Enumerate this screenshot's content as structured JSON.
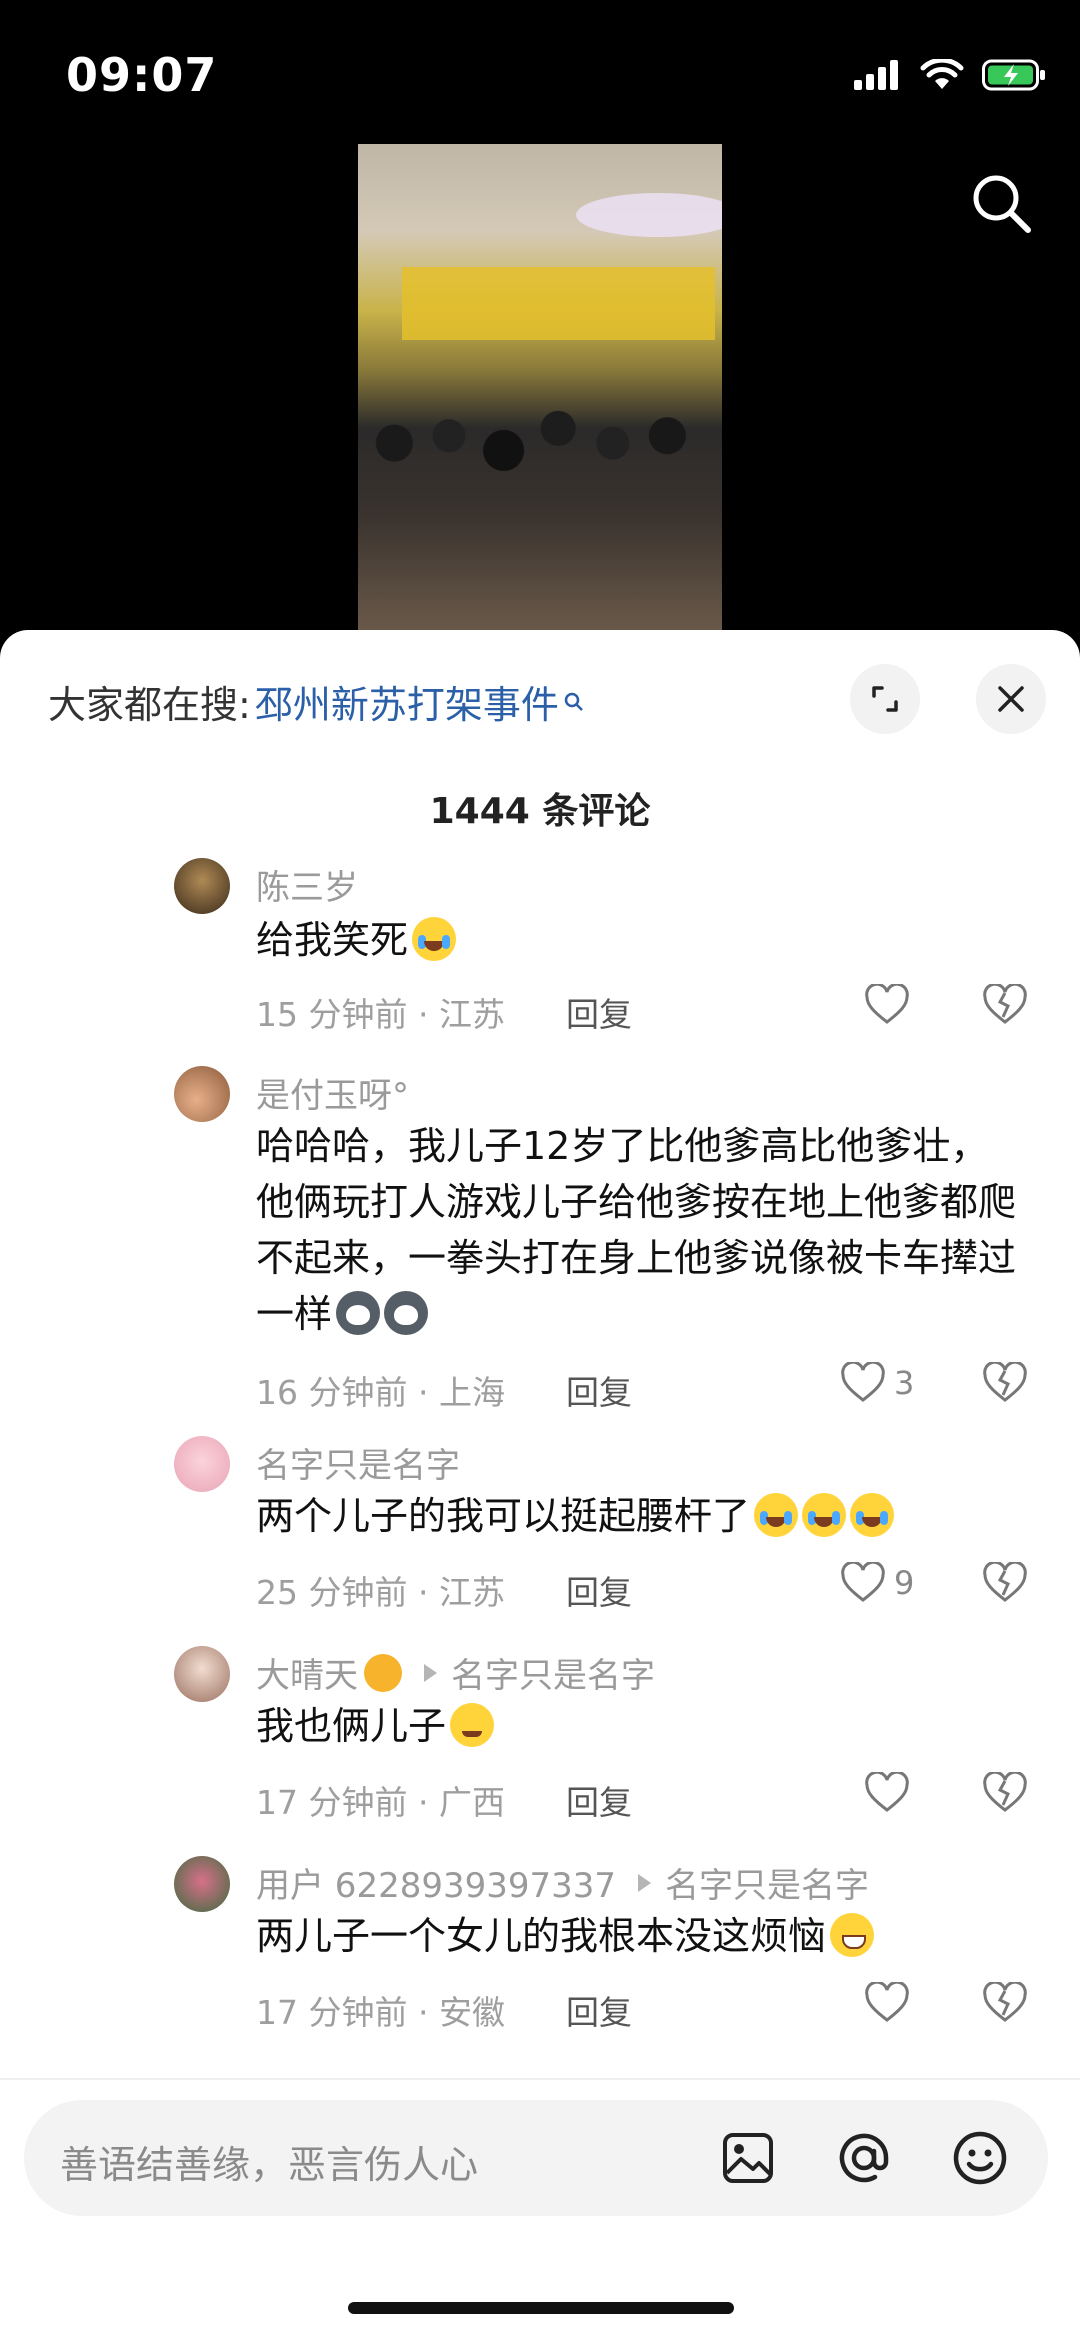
{
  "status": {
    "time": "09:07"
  },
  "search": {
    "prefix": "大家都在搜:",
    "term": "邳州新苏打架事件"
  },
  "comments_header": {
    "count_label": "1444 条评论"
  },
  "reply_label": "回复",
  "comments": [
    {
      "name": "陈三岁",
      "text": "给我笑死",
      "time": "15 分钟前 · 江苏",
      "likes": ""
    },
    {
      "name": "是付玉呀°",
      "text": "哈哈哈，我儿子12岁了比他爹高比他爹壮，他俩玩打人游戏儿子给他爹按在地上他爹都爬不起来，一拳头打在身上他爹说像被卡车撵过一样",
      "time": "16 分钟前 · 上海",
      "likes": "3"
    },
    {
      "name": "名字只是名字",
      "text": "两个儿子的我可以挺起腰杆了",
      "time": "25 分钟前 · 江苏",
      "likes": "9"
    },
    {
      "name": "大晴天",
      "reply_to": "名字只是名字",
      "text": "我也俩儿子",
      "time": "17 分钟前 · 广西",
      "likes": ""
    },
    {
      "name": "用户 6228939397337",
      "reply_to": "名字只是名字",
      "text": "两儿子一个女儿的我根本没这烦恼",
      "time": "17 分钟前 · 安徽",
      "likes": ""
    }
  ],
  "input": {
    "placeholder": "善语结善缘，恶言伤人心"
  },
  "icons": {
    "search": "search-icon",
    "expand": "expand-icon",
    "close": "close-icon",
    "like": "heart-icon",
    "dislike": "broken-heart-icon",
    "image": "image-icon",
    "mention": "at-icon",
    "emoji": "emoji-icon"
  },
  "colors": {
    "link": "#2b5fa8",
    "sheet": "#ffffff",
    "meta": "#9e9e9e"
  }
}
